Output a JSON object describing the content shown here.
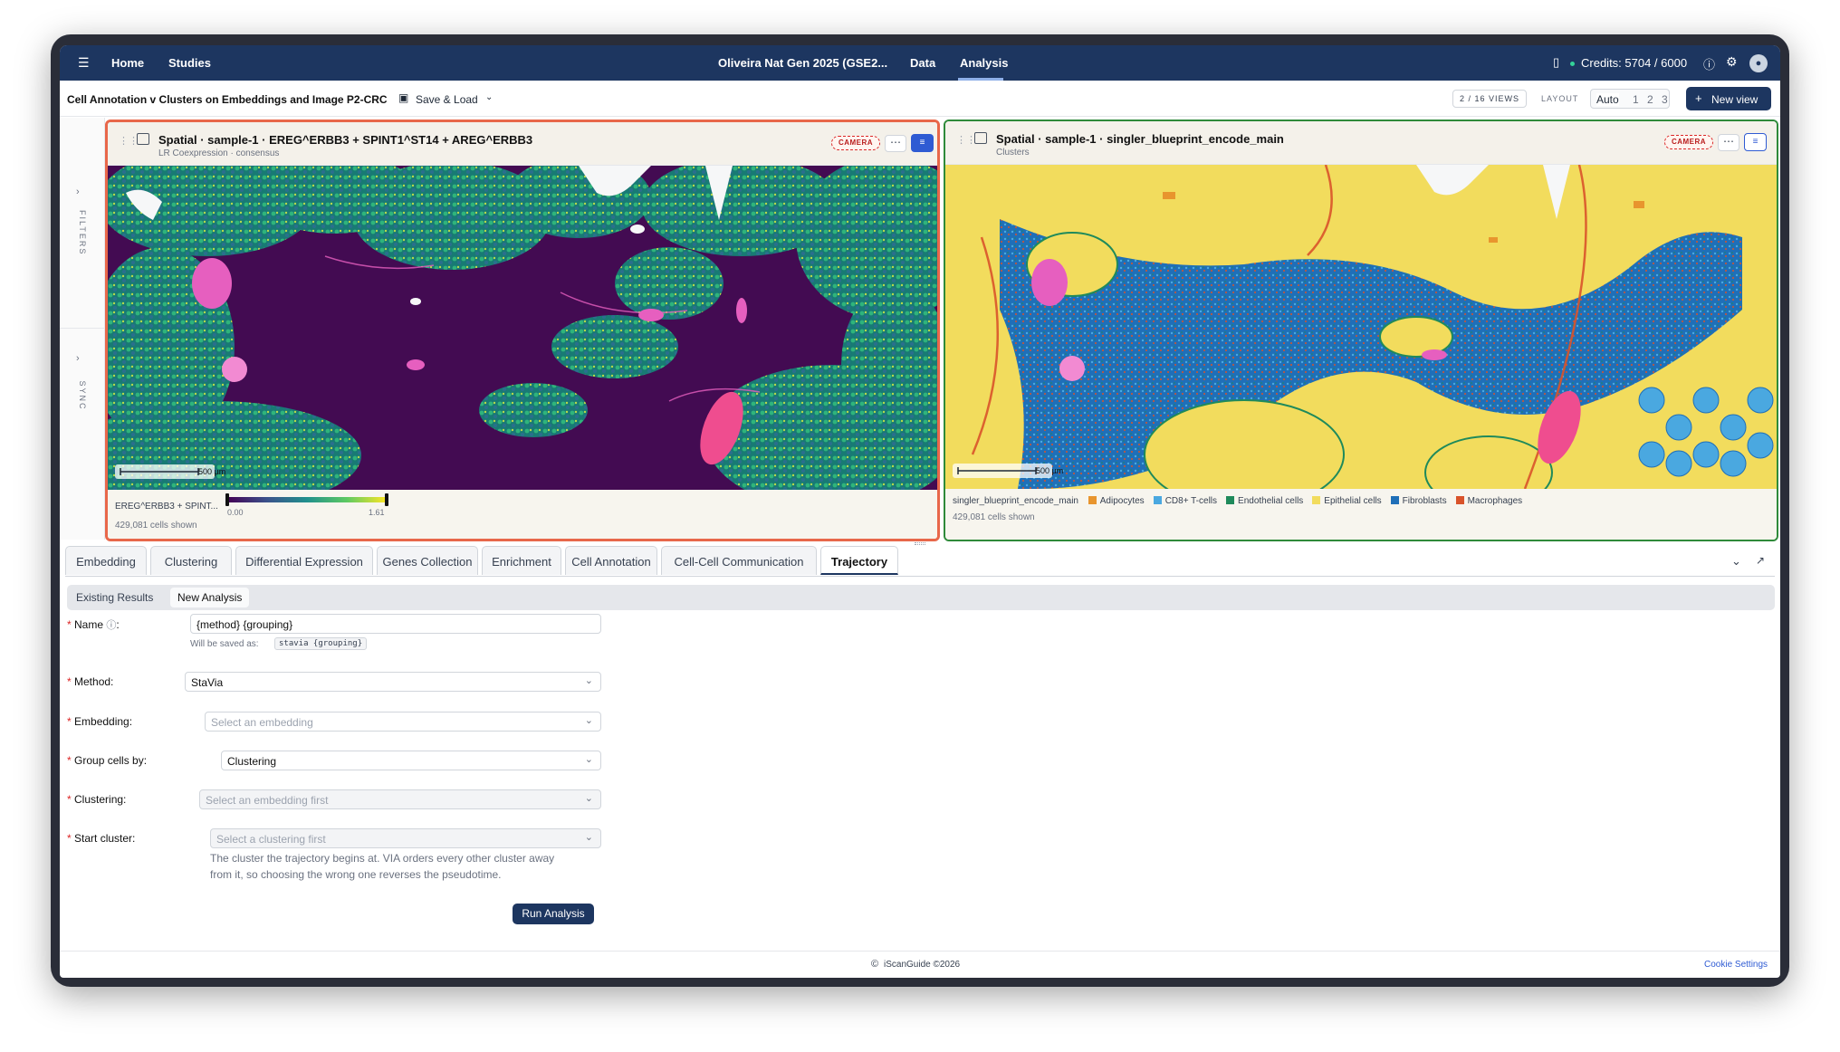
{
  "nav": {
    "home": "Home",
    "studies": "Studies",
    "project_title": "Oliveira Nat Gen 2025 (GSE2...",
    "data": "Data",
    "analysis": "Analysis",
    "credits": "Credits: 5704 / 6000"
  },
  "subbar": {
    "title": "Cell Annotation v Clusters on Embeddings and Image P2-CRC",
    "save_load": "Save & Load",
    "views": "2 / 16 VIEWS",
    "layout": "LAYOUT",
    "layout_auto": "Auto",
    "layout_1": "1",
    "layout_2": "2",
    "layout_3": "3",
    "new_view": "New view"
  },
  "rail": {
    "filters": "FILTERS",
    "sync": "SYNC"
  },
  "panel_left": {
    "title": "Spatial · sample-1 · EREG^ERBB3 + SPINT1^ST14 + AREG^ERBB3",
    "subtitle": "LR Coexpression · consensus",
    "camera": "CAMERA",
    "scale": "500 µm",
    "colorbar_label": "EREG^ERBB3 + SPINT...",
    "colorbar_min": "0.00",
    "colorbar_max": "1.61",
    "cells": "429,081 cells shown"
  },
  "panel_right": {
    "title": "Spatial · sample-1 · singler_blueprint_encode_main",
    "subtitle": "Clusters",
    "camera": "CAMERA",
    "scale": "500 µm",
    "legend_title": "singler_blueprint_encode_main",
    "legend": [
      {
        "label": "Adipocytes",
        "color": "#e8952e"
      },
      {
        "label": "CD8+ T-cells",
        "color": "#4aa8e0"
      },
      {
        "label": "Endothelial cells",
        "color": "#1f8a5b"
      },
      {
        "label": "Epithelial cells",
        "color": "#f2dc5d"
      },
      {
        "label": "Fibroblasts",
        "color": "#1f6fb8"
      },
      {
        "label": "Macrophages",
        "color": "#d9532a"
      }
    ],
    "cells": "429,081 cells shown"
  },
  "tabs": [
    "Embedding",
    "Clustering",
    "Differential Expression",
    "Genes Collection",
    "Enrichment",
    "Cell Annotation",
    "Cell-Cell Communication",
    "Trajectory"
  ],
  "subtabs": {
    "existing": "Existing Results",
    "new": "New Analysis"
  },
  "form": {
    "name_label": "Name",
    "name_value": "{method} {grouping}",
    "saved_as": "Will be saved as:",
    "saved_code": "stavia {grouping}",
    "method_label": "Method",
    "method_value": "StaVia",
    "embedding_label": "Embedding",
    "embedding_placeholder": "Select an embedding",
    "group_label": "Group cells by",
    "group_value": "Clustering",
    "clustering_label": "Clustering",
    "clustering_placeholder": "Select an embedding first",
    "start_label": "Start cluster",
    "start_placeholder": "Select a clustering first",
    "help_line1": "The cluster the trajectory begins at. VIA orders every other cluster away",
    "help_line2": "from it, so choosing the wrong one reverses the pseudotime.",
    "run": "Run Analysis"
  },
  "footer": {
    "copyright": "iScanGuide ©2026",
    "cookie": "Cookie Settings"
  },
  "colors": {
    "nav_bg": "#1d3660",
    "accent": "#2f5bd3",
    "left_panel_border": "#e8674a",
    "right_panel_border": "#2f8a3a"
  }
}
